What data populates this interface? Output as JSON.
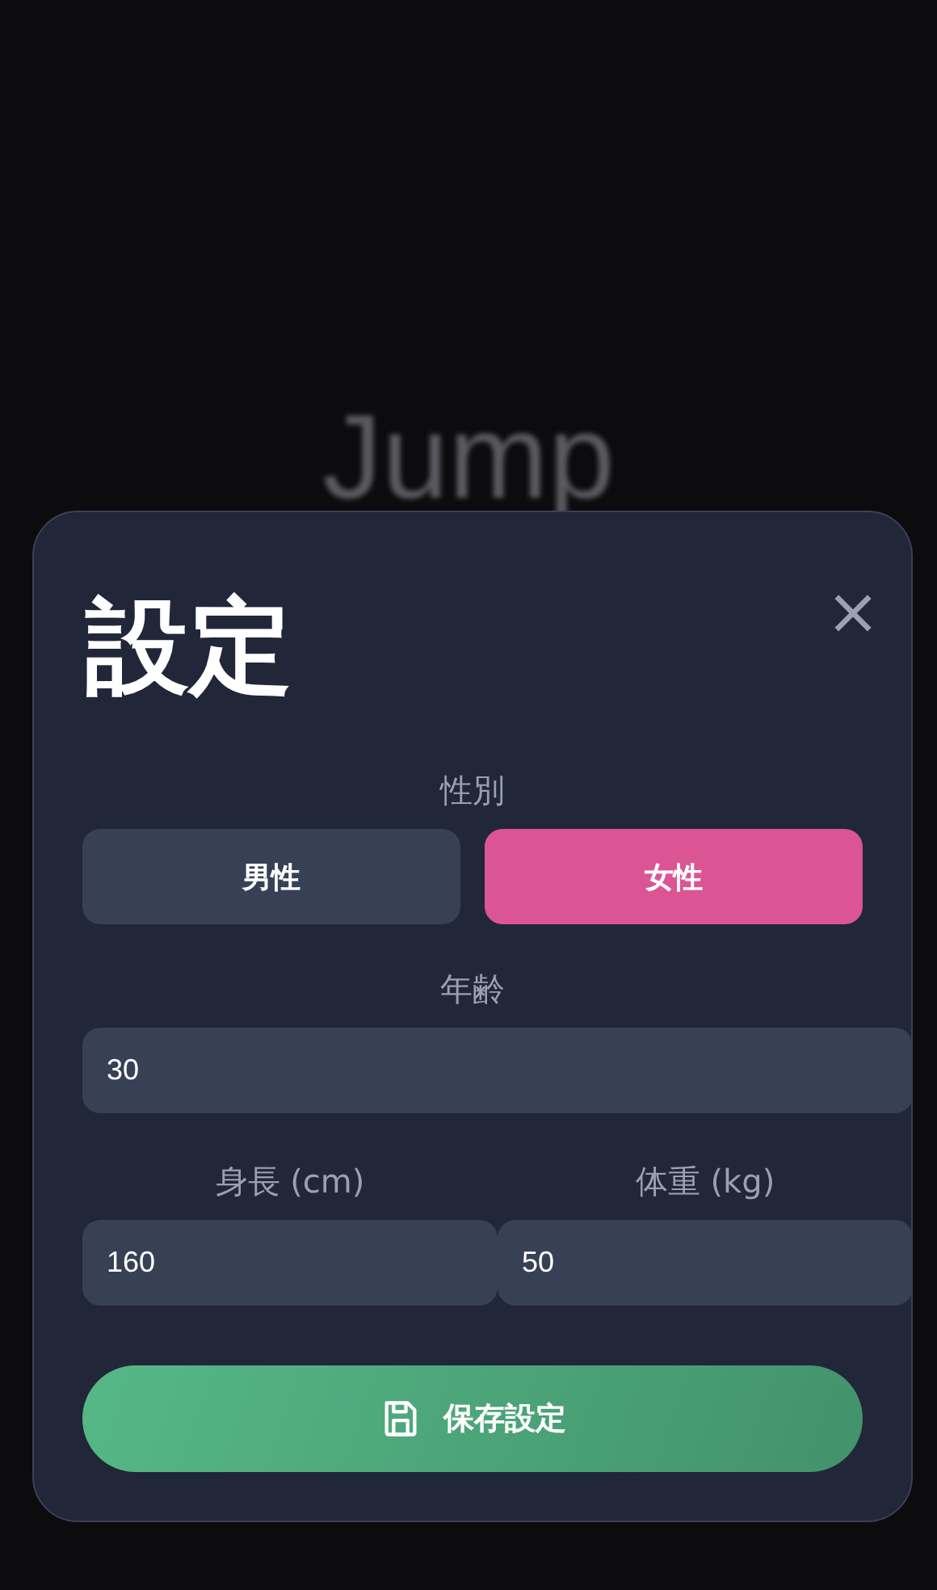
{
  "background": {
    "title": "Jump"
  },
  "dialog": {
    "title": "設定",
    "close": "×",
    "gender": {
      "label": "性別",
      "options": [
        {
          "label": "男性",
          "selected": false
        },
        {
          "label": "女性",
          "selected": true
        }
      ]
    },
    "age": {
      "label": "年齢",
      "value": "30"
    },
    "body": [
      {
        "label": "身長 (cm)",
        "value": "160"
      },
      {
        "label": "体重 (kg)",
        "value": "50"
      }
    ],
    "save": {
      "label": "保存設定"
    }
  }
}
